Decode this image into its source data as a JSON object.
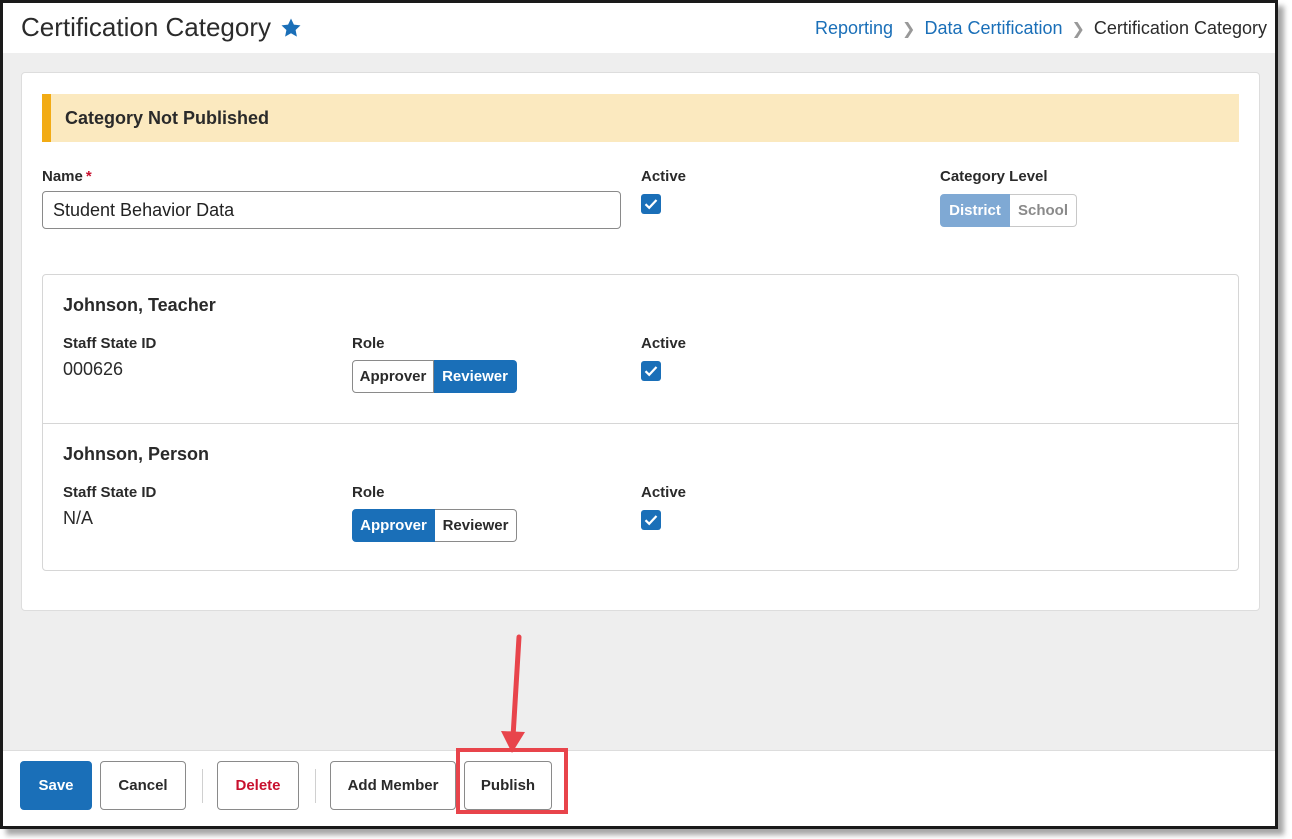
{
  "header": {
    "title": "Certification Category",
    "breadcrumb": [
      "Reporting",
      "Data Certification",
      "Certification Category"
    ]
  },
  "banner": {
    "text": "Category Not Published"
  },
  "form": {
    "name_label": "Name",
    "required_mark": "*",
    "name_value": "Student Behavior Data",
    "active_label": "Active",
    "active_checked": true,
    "category_level_label": "Category Level",
    "category_level_options": [
      "District",
      "School"
    ],
    "category_level_selected": "District"
  },
  "members": [
    {
      "name": "Johnson, Teacher",
      "staff_state_id_label": "Staff State ID",
      "staff_state_id": "000626",
      "role_label": "Role",
      "role_options": [
        "Approver",
        "Reviewer"
      ],
      "role_selected": "Reviewer",
      "active_label": "Active",
      "active_checked": true
    },
    {
      "name": "Johnson, Person",
      "staff_state_id_label": "Staff State ID",
      "staff_state_id": "N/A",
      "role_label": "Role",
      "role_options": [
        "Approver",
        "Reviewer"
      ],
      "role_selected": "Approver",
      "active_label": "Active",
      "active_checked": true
    }
  ],
  "footer": {
    "save": "Save",
    "cancel": "Cancel",
    "delete": "Delete",
    "add_member": "Add Member",
    "publish": "Publish"
  },
  "colors": {
    "accent": "#1a6fb8",
    "banner_bg": "#fbe9bf",
    "banner_bar": "#f2ab14",
    "danger": "#c8102e",
    "annotation": "#e8444b"
  },
  "icons": [
    "star-icon",
    "chevron-right-icon",
    "checkmark-icon",
    "arrow-down-annotation"
  ]
}
